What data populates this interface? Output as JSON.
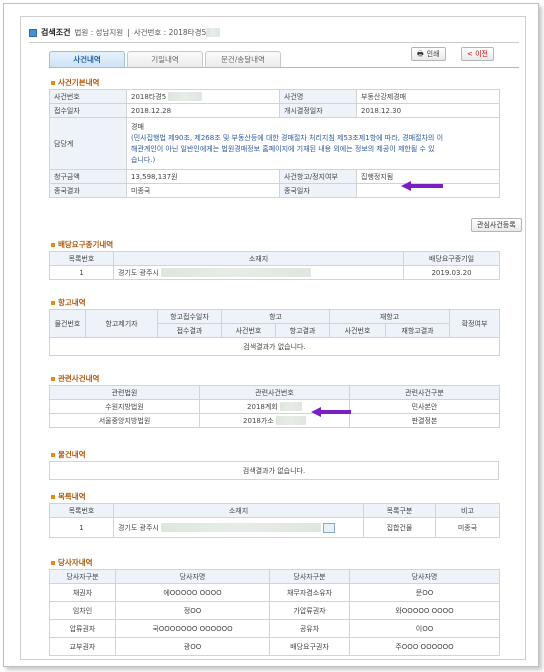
{
  "header": {
    "title": "검색조건",
    "court_label": "법원 : 성남지원",
    "sep": "|",
    "case_label": "사건번호 : 2018타경5"
  },
  "tabs": [
    "사건내역",
    "기일내역",
    "문건/송달내역"
  ],
  "buttons": {
    "print": "인쇄",
    "prev": "< 이전",
    "register": "관심사건등록"
  },
  "basic": {
    "title": "사건기본내역",
    "rows": [
      [
        "사건번호",
        "2018타경5",
        "사건명",
        "부동산강제경매"
      ],
      [
        "접수일자",
        "2018.12.28",
        "개시결정일자",
        "2018.12.30"
      ]
    ],
    "ddang_label": "담당계",
    "ddang_l1": "경매",
    "ddang_l2": "(민사집행법 제90조, 제268조 및 부동산등에 대한 경매절차 처리지침 제53조제1항에 따라, 경매절차의 이",
    "ddang_l3": "해관계인이 아닌 일반인에게는 법원경매정보 홈페이지에 기재된 내용 외에는 정보의 제공이 제한될 수 있",
    "ddang_l4": "습니다.)",
    "claim_label": "청구금액",
    "claim": "13,598,137원",
    "stop_label": "사건항고/정지여부",
    "stop": "집행정지됨",
    "end_label": "종국결과",
    "end": "미종국",
    "enddate_label": "종국일자",
    "enddate": ""
  },
  "dist": {
    "title": "배당요구종기내역",
    "headers": [
      "목록번호",
      "소재지",
      "배당요구종기일"
    ],
    "row": [
      "1",
      "경기도 광주시",
      "2019.03.20"
    ]
  },
  "appeal": {
    "title": "항고내역",
    "h1": [
      "물건번호",
      "항고제기자",
      "항고접수일자",
      "항고",
      "재항고",
      "확정여부"
    ],
    "h2": [
      "접수결과",
      "사건번호",
      "항고결과",
      "사건번호",
      "재항고결과"
    ],
    "empty": "검색결과가 없습니다."
  },
  "related": {
    "title": "관련사건내역",
    "headers": [
      "관련법원",
      "관련사건번호",
      "관련사건구분"
    ],
    "rows": [
      [
        "수원지방법원",
        "2018계회",
        "민사본안"
      ],
      [
        "서울중앙지방법원",
        "2018가소",
        "판결정본"
      ]
    ]
  },
  "goods": {
    "title": "물건내역",
    "empty": "검색결과가 없습니다."
  },
  "list": {
    "title": "목록내역",
    "headers": [
      "목록번호",
      "소재지",
      "목록구분",
      "비고"
    ],
    "row": [
      "1",
      "경기도 광주시",
      "집합건물",
      "미종국"
    ]
  },
  "parties": {
    "title": "당사자내역",
    "headers": [
      "당사자구분",
      "당사자명",
      "당사자구분",
      "당사자명"
    ],
    "rows": [
      [
        "채권자",
        "에OOOOO OOOO",
        "채무자겸소유자",
        "문OO"
      ],
      [
        "임차인",
        "정OO",
        "가압류권자",
        "와OOOOO OOOO"
      ],
      [
        "압류권자",
        "국OOOOOOO OOOOOO",
        "공유자",
        "이OO"
      ],
      [
        "교부권자",
        "광OO",
        "배당요구권자",
        "주OOO OOOOOO"
      ]
    ]
  }
}
